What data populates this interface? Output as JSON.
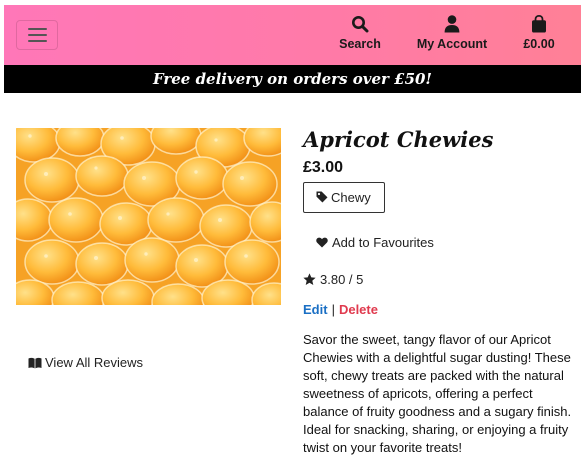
{
  "navbar": {
    "toggler": {
      "icon": "hamburger-menu-icon"
    },
    "items": [
      {
        "label": "Search",
        "icon": "search-icon"
      },
      {
        "label": "My Account",
        "icon": "user-icon"
      },
      {
        "label": "£0.00",
        "icon": "shopping-bag-icon"
      }
    ],
    "gradient_start": "#ff77b8",
    "gradient_end": "#ff8096"
  },
  "banner": {
    "text": "Free delivery on orders over £50!"
  },
  "product": {
    "image": {
      "icon": "product-image",
      "alt": "Apricot Chewies sweets"
    },
    "name": "Apricot Chewies",
    "price": "£3.00",
    "category": {
      "label": "Chewy",
      "icon": "tag-icon"
    },
    "favourite": {
      "label": "Add to Favourites",
      "icon": "heart-icon"
    },
    "rating": {
      "value": "3.80 / 5",
      "icon": "star-icon"
    },
    "admin": {
      "edit": "Edit",
      "separator": "|",
      "delete": "Delete"
    },
    "description": "Savor the sweet, tangy flavor of our Apricot Chewies with a delightful sugar dusting! These soft, chewy treats are packed with the natural sweetness of apricots, offering a perfect balance of fruity goodness and a sugary finish. Ideal for snacking, sharing, or enjoying a fruity twist on your favorite treats!"
  },
  "reviews": {
    "label": "View All Reviews",
    "icon": "book-open-icon"
  },
  "colors": {
    "edit": "#1a6fc4",
    "delete": "#e03a4e",
    "banner_bg": "#000000"
  }
}
